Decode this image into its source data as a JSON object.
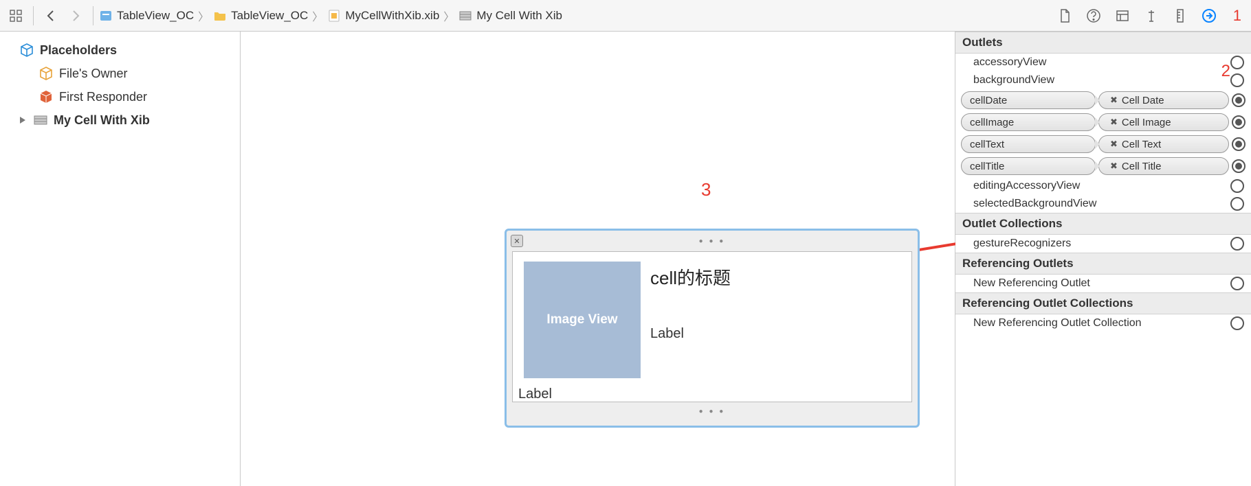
{
  "breadcrumb": {
    "proj": "TableView_OC",
    "folder": "TableView_OC",
    "file": "MyCellWithXib.xib",
    "object": "My Cell With Xib"
  },
  "navigator": {
    "placeholders_title": "Placeholders",
    "files_owner": "File's Owner",
    "first_responder": "First Responder",
    "my_cell": "My Cell With Xib"
  },
  "canvas": {
    "image_view": "Image View",
    "title": "cell的标题",
    "label_text": "Label",
    "label_date": "Label"
  },
  "inspector": {
    "sections": {
      "outlets": "Outlets",
      "outlet_collections": "Outlet Collections",
      "ref_outlets": "Referencing Outlets",
      "ref_outlet_collections": "Referencing Outlet Collections"
    },
    "outlets": {
      "accessoryView": "accessoryView",
      "backgroundView": "backgroundView",
      "editingAccessoryView": "editingAccessoryView",
      "selectedBackgroundView": "selectedBackgroundView"
    },
    "connected": [
      {
        "src": "cellDate",
        "dst": "Cell Date"
      },
      {
        "src": "cellImage",
        "dst": "Cell Image"
      },
      {
        "src": "cellText",
        "dst": "Cell Text"
      },
      {
        "src": "cellTitle",
        "dst": "Cell Title"
      }
    ],
    "gestureRecognizers": "gestureRecognizers",
    "new_ref_outlet": "New Referencing Outlet",
    "new_ref_outlet_coll": "New Referencing Outlet Collection"
  },
  "annotations": {
    "a1": "1",
    "a2": "2",
    "a3": "3"
  }
}
